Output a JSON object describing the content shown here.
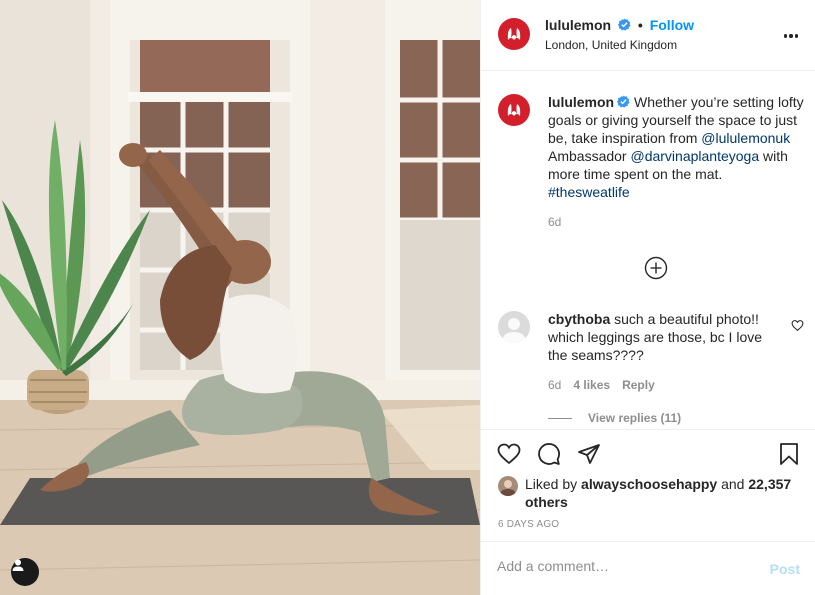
{
  "post": {
    "account": {
      "username": "lululemon",
      "verified": true,
      "follow_label": "Follow",
      "location": "London, United Kingdom"
    },
    "caption": {
      "username": "lululemon",
      "text_before": "Whether you’re setting lofty goals or giving yourself the space to just be, take inspiration from ",
      "mention_1": "@lululemonuk",
      "text_middle": " Ambassador ",
      "mention_2": "@darvinaplanteyoga",
      "text_after": " with more time spent on the mat. ",
      "hashtag": "#thesweatlife",
      "age": "6d"
    },
    "comment": {
      "username": "cbythoba",
      "text": "such a beautiful photo!! which leggings are those, bc I love the seams????",
      "age": "6d",
      "likes": "4 likes",
      "reply_label": "Reply",
      "view_replies": "View replies (11)"
    },
    "likes": {
      "prefix": "Liked by",
      "user": "alwayschoosehappy",
      "joiner": "and",
      "others": "22,357 others"
    },
    "date": "6 DAYS AGO",
    "add_comment": {
      "placeholder": "Add a comment…",
      "post_label": "Post"
    }
  },
  "colors": {
    "brand_red": "#d31f2c",
    "link_blue": "#0095f6",
    "mention_blue": "#00376b",
    "muted": "#8e8e8e"
  },
  "icons": [
    "lululemon-logo-icon",
    "verified-badge-icon",
    "more-options-icon",
    "load-more-icon",
    "heart-icon",
    "comment-icon",
    "share-icon",
    "bookmark-icon",
    "tag-user-icon"
  ]
}
